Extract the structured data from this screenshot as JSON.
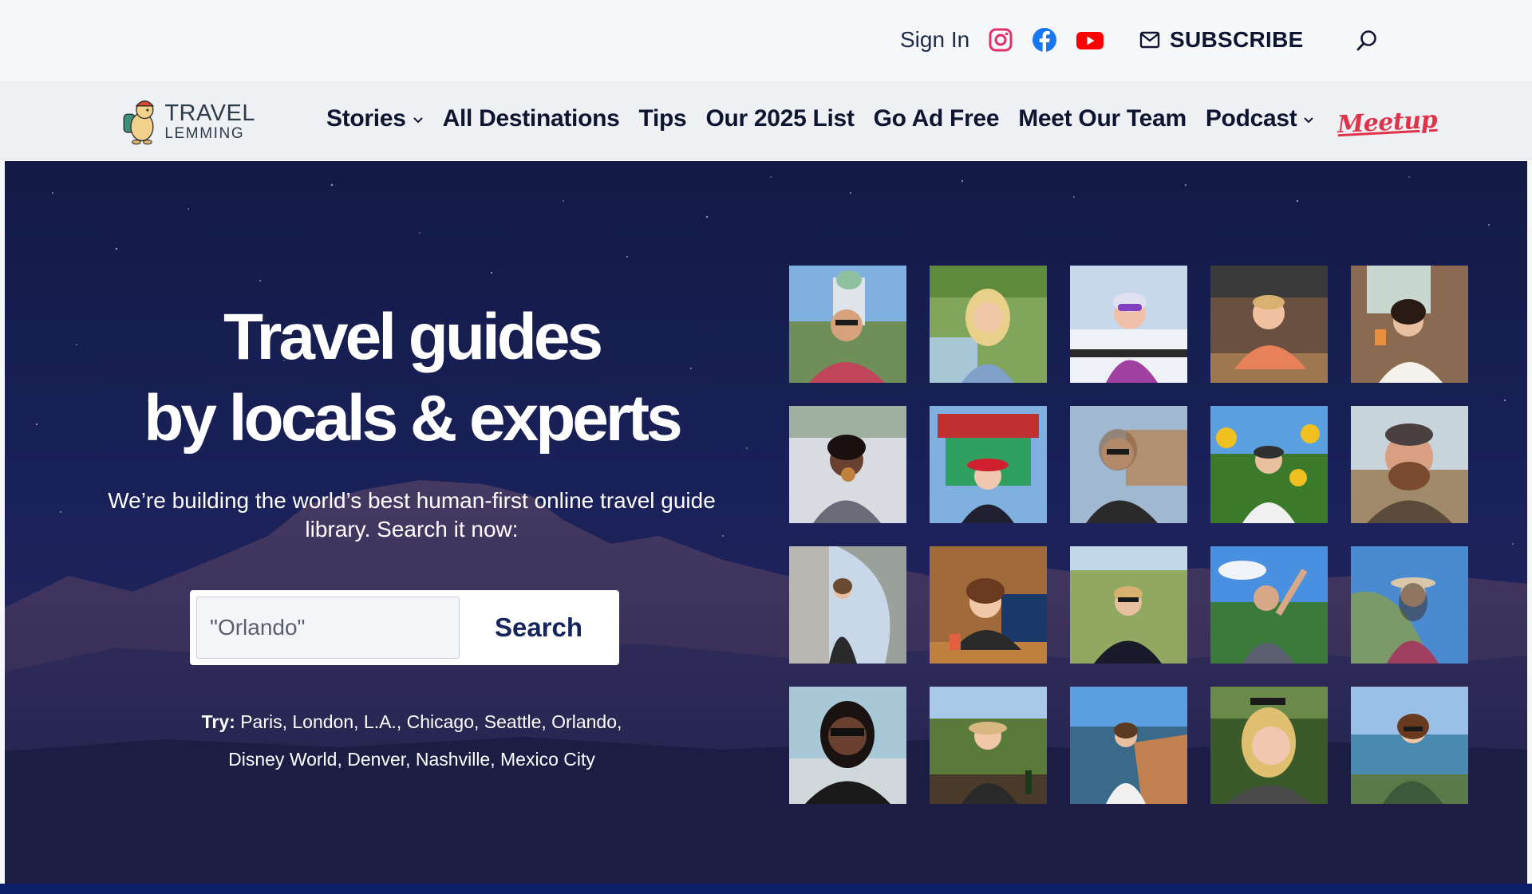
{
  "topbar": {
    "sign_in": "Sign In",
    "social": [
      {
        "name": "instagram-icon",
        "color": "#e1306c"
      },
      {
        "name": "facebook-icon",
        "color": "#1877f2"
      },
      {
        "name": "youtube-icon",
        "color": "#ff0000"
      }
    ],
    "subscribe": "SUBSCRIBE",
    "subscribe_icon": "mail-icon",
    "search_icon": "search-icon"
  },
  "logo": {
    "line1": "TRAVEL",
    "line2": "LEMMING"
  },
  "nav": {
    "items": [
      {
        "label": "Stories",
        "dropdown": true
      },
      {
        "label": "All Destinations",
        "dropdown": false
      },
      {
        "label": "Tips",
        "dropdown": false
      },
      {
        "label": "Our 2025 List",
        "dropdown": false
      },
      {
        "label": "Go Ad Free",
        "dropdown": false
      },
      {
        "label": "Meet Our Team",
        "dropdown": false
      },
      {
        "label": "Podcast",
        "dropdown": true
      }
    ],
    "meetup": "Meetup"
  },
  "hero": {
    "headline_line1": "Travel guides",
    "headline_line2": "by locals & experts",
    "subhead": "We’re building the world’s best human-first online travel guide library. Search it now:",
    "search": {
      "placeholder": "\"Orlando\"",
      "button": "Search"
    },
    "try_label": "Try:",
    "try_links": [
      "Paris",
      "London",
      "L.A.",
      "Chicago",
      "Seattle",
      "Orlando",
      "Disney World",
      "Denver",
      "Nashville",
      "Mexico City"
    ]
  },
  "colors": {
    "hero_bg": "#1a2159",
    "nav_text": "#0e1530",
    "meetup": "#e0334a",
    "search_button_text": "#15245c",
    "bottom_bar": "#0c1e6a"
  }
}
